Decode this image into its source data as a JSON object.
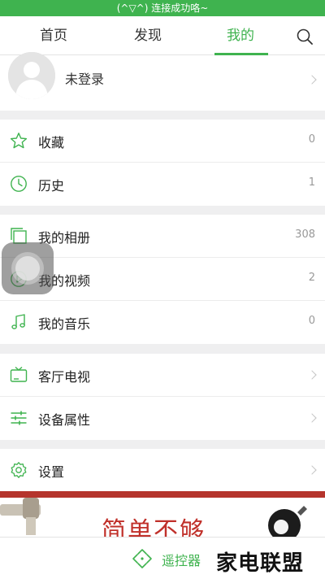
{
  "status": {
    "message": "(^▽^) 连接成功咯~"
  },
  "tabs": [
    {
      "label": "首页"
    },
    {
      "label": "发现"
    },
    {
      "label": "我的",
      "active": true
    }
  ],
  "profile": {
    "name": "未登录"
  },
  "section1": [
    {
      "label": "收藏",
      "count": "0",
      "icon": "star-icon"
    },
    {
      "label": "历史",
      "count": "1",
      "icon": "clock-icon"
    }
  ],
  "section2": [
    {
      "label": "我的相册",
      "count": "308",
      "icon": "album-icon"
    },
    {
      "label": "我的视频",
      "count": "2",
      "icon": "play-icon"
    },
    {
      "label": "我的音乐",
      "count": "0",
      "icon": "music-note-icon"
    }
  ],
  "section3": [
    {
      "label": "客厅电视",
      "icon": "tv-icon"
    },
    {
      "label": "设备属性",
      "icon": "sliders-icon"
    }
  ],
  "section4": [
    {
      "label": "设置",
      "icon": "gear-icon"
    }
  ],
  "banner": {
    "text": "简单不够"
  },
  "bottom": {
    "remote_label": "遥控器"
  },
  "watermark": {
    "text": "家电联盟"
  },
  "colors": {
    "accent": "#3fb34f",
    "banner_red": "#b5342d",
    "background": "#efeff0"
  }
}
